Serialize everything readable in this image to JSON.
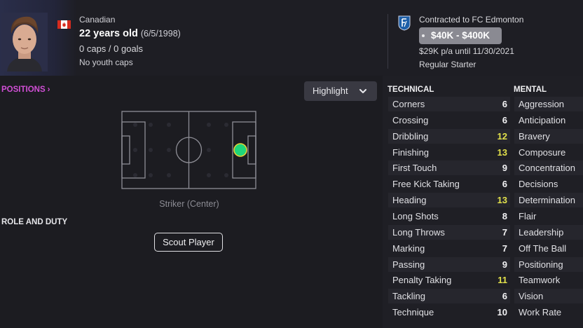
{
  "header": {
    "nationality": "Canadian",
    "age": "22 years old",
    "dob": "(6/5/1998)",
    "caps": "0 caps / 0 goals",
    "youth_caps": "No youth caps",
    "contract": "Contracted to FC Edmonton",
    "wage_range": "$40K - $400K",
    "wage_detail": "$29K p/a until 11/30/2021",
    "squad_status": "Regular Starter",
    "flag_icon": "canada-flag-icon",
    "club_icon": "fc-edmonton-badge-icon"
  },
  "positions": {
    "title": "POSITIONS",
    "chevron": "›",
    "position_label": "Striker (Center)",
    "highlight_dropdown": "Highlight"
  },
  "role": {
    "title": "ROLE AND DUTY",
    "scout_button": "Scout Player"
  },
  "colors": {
    "accent_magenta": "#d14fd6",
    "highlight_yellow": "#e2e14b",
    "position_green": "#1fd67a"
  },
  "attributes": {
    "technical_title": "TECHNICAL",
    "mental_title": "MENTAL",
    "technical": [
      {
        "name": "Corners",
        "value": "6"
      },
      {
        "name": "Crossing",
        "value": "6"
      },
      {
        "name": "Dribbling",
        "value": "12",
        "highlight": true
      },
      {
        "name": "Finishing",
        "value": "13",
        "highlight": true
      },
      {
        "name": "First Touch",
        "value": "9"
      },
      {
        "name": "Free Kick Taking",
        "value": "6"
      },
      {
        "name": "Heading",
        "value": "13",
        "highlight": true
      },
      {
        "name": "Long Shots",
        "value": "8"
      },
      {
        "name": "Long Throws",
        "value": "7"
      },
      {
        "name": "Marking",
        "value": "7"
      },
      {
        "name": "Passing",
        "value": "9"
      },
      {
        "name": "Penalty Taking",
        "value": "11",
        "highlight": true
      },
      {
        "name": "Tackling",
        "value": "6"
      },
      {
        "name": "Technique",
        "value": "10"
      }
    ],
    "mental": [
      "Aggression",
      "Anticipation",
      "Bravery",
      "Composure",
      "Concentration",
      "Decisions",
      "Determination",
      "Flair",
      "Leadership",
      "Off The Ball",
      "Positioning",
      "Teamwork",
      "Vision",
      "Work Rate"
    ]
  }
}
